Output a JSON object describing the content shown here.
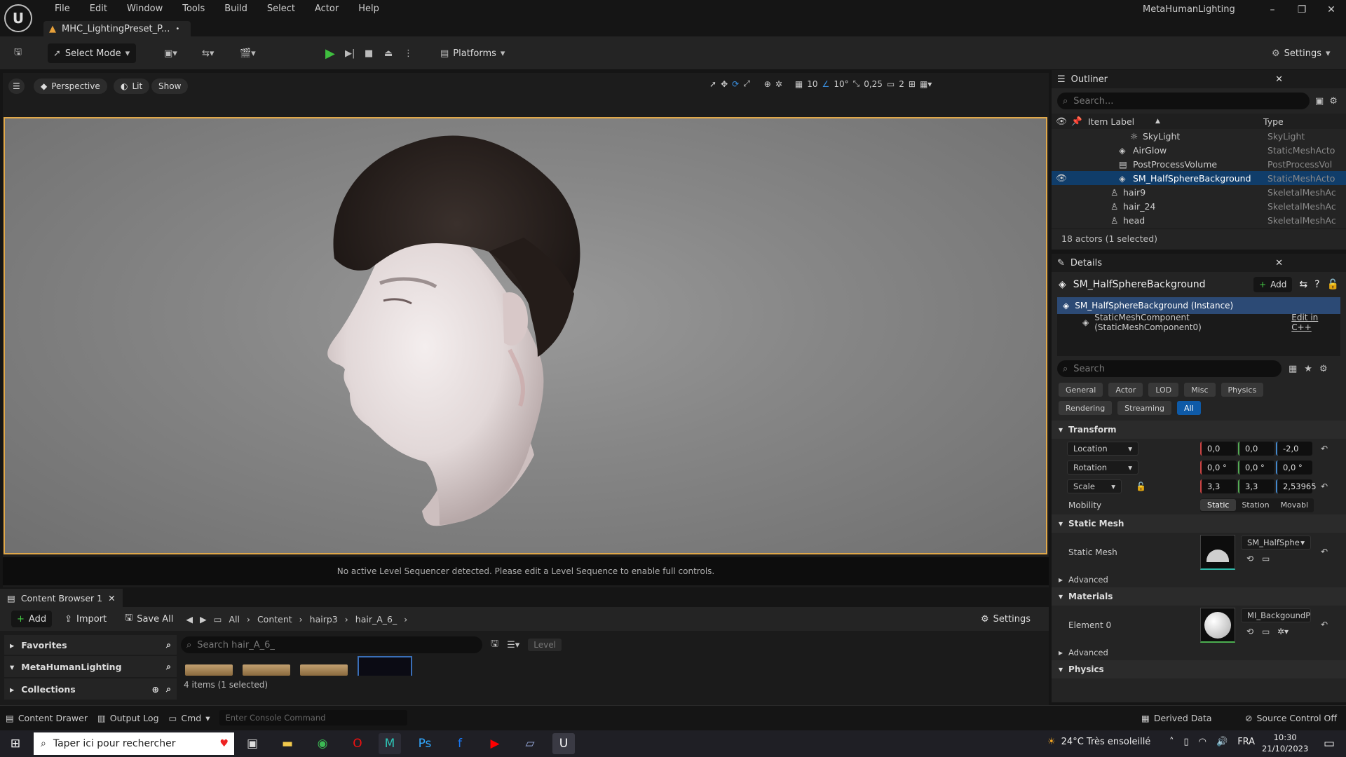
{
  "titlebar": {
    "menu": [
      "File",
      "Edit",
      "Window",
      "Tools",
      "Build",
      "Select",
      "Actor",
      "Help"
    ],
    "doc_tab": "MHC_LightingPreset_P...",
    "doc_tab_dirty": "•",
    "app_title": "MetaHumanLighting",
    "window_controls": [
      "–",
      "❐",
      "✕"
    ]
  },
  "toolbar": {
    "select_mode": "Select Mode",
    "platforms": "Platforms",
    "settings": "Settings"
  },
  "viewport": {
    "perspective": "Perspective",
    "lit": "Lit",
    "show": "Show",
    "grid_snap": "10",
    "rot_snap": "10°",
    "scale_snap": "0,25",
    "camera_speed": "2",
    "sequencer_message": "No active Level Sequencer detected. Please edit a Level Sequence to enable full controls."
  },
  "outliner": {
    "title": "Outliner",
    "search_placeholder": "Search...",
    "col_label": "Item Label",
    "col_type": "Type",
    "rows": [
      {
        "label": "SkyLight",
        "type": "SkyLight",
        "icon": "skylight-icon"
      },
      {
        "label": "AirGlow",
        "type": "StaticMeshActo",
        "icon": "static-mesh-icon"
      },
      {
        "label": "PostProcessVolume",
        "type": "PostProcessVol",
        "icon": "volume-icon"
      },
      {
        "label": "SM_HalfSphereBackground",
        "type": "StaticMeshActo",
        "icon": "static-mesh-icon"
      },
      {
        "label": "hair9",
        "type": "SkeletalMeshAc",
        "icon": "skeletal-mesh-icon"
      },
      {
        "label": "hair_24",
        "type": "SkeletalMeshAc",
        "icon": "skeletal-mesh-icon"
      },
      {
        "label": "head",
        "type": "SkeletalMeshAc",
        "icon": "skeletal-mesh-icon"
      }
    ],
    "footer": "18 actors (1 selected)"
  },
  "details": {
    "title": "Details",
    "actor_name": "SM_HalfSphereBackground",
    "add": "Add",
    "instance": "SM_HalfSphereBackground (Instance)",
    "component": "StaticMeshComponent (StaticMeshComponent0)",
    "edit_cpp": "Edit in C++",
    "search_placeholder": "Search",
    "categories_row1": [
      "General",
      "Actor",
      "LOD",
      "Misc",
      "Physics"
    ],
    "categories_row2": [
      "Rendering",
      "Streaming",
      "All"
    ],
    "transform": {
      "title": "Transform",
      "location_label": "Location",
      "location": [
        "0,0",
        "0,0",
        "-2,0"
      ],
      "rotation_label": "Rotation",
      "rotation": [
        "0,0 °",
        "0,0 °",
        "0,0 °"
      ],
      "scale_label": "Scale",
      "scale": [
        "3,3",
        "3,3",
        "2,53965"
      ],
      "mobility_label": "Mobility",
      "mobility": [
        "Static",
        "Station",
        "Movabl"
      ]
    },
    "static_mesh": {
      "title": "Static Mesh",
      "label": "Static Mesh",
      "value": "SM_HalfSphe",
      "advanced": "Advanced"
    },
    "materials": {
      "title": "Materials",
      "label": "Element 0",
      "value": "MI_BackgoundPlane",
      "advanced": "Advanced"
    },
    "physics": {
      "title": "Physics"
    }
  },
  "content_browser": {
    "tab": "Content Browser 1",
    "add": "Add",
    "import": "Import",
    "save_all": "Save All",
    "path": [
      "All",
      "Content",
      "hairp3",
      "hair_A_6_"
    ],
    "settings": "Settings",
    "favorites": "Favorites",
    "project": "MetaHumanLighting",
    "collections": "Collections",
    "search_placeholder": "Search hair_A_6_",
    "level_filter": "Level",
    "status": "4 items (1 selected)"
  },
  "statusbar": {
    "content_drawer": "Content Drawer",
    "output_log": "Output Log",
    "cmd": "Cmd",
    "console_placeholder": "Enter Console Command",
    "derived_data": "Derived Data",
    "source_control": "Source Control Off"
  },
  "taskbar": {
    "search": "Taper ici pour rechercher",
    "weather": "24°C  Très ensoleillé",
    "lang": "FRA",
    "time": "10:30",
    "date": "21/10/2023"
  },
  "colors": {
    "accent": "#0e5aa7",
    "selection": "#103d6a",
    "viewport_border": "#e0a84a"
  }
}
